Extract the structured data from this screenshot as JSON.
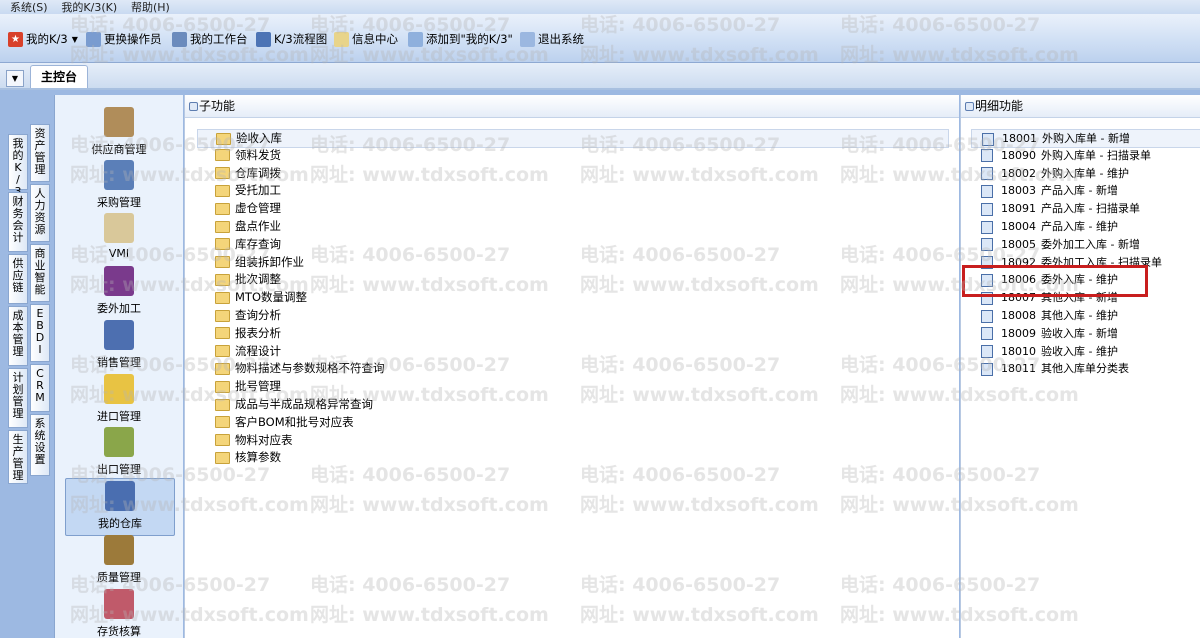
{
  "menubar": [
    "系统(S)",
    "我的K/3(K)",
    "帮助(H)"
  ],
  "toolbar": {
    "my_k3": "我的K/3",
    "switch_operator": "更换操作员",
    "my_workbench": "我的工作台",
    "k3_flowchart": "K/3流程图",
    "info_center": "信息中心",
    "add_to_my_k3": "添加到\"我的K/3\"",
    "exit_system": "退出系统"
  },
  "tabs": {
    "main": "主控台"
  },
  "left_tabs": {
    "col1": [
      [
        "我",
        "的",
        "K",
        "/",
        "3"
      ],
      [
        "财",
        "务",
        "会",
        "计"
      ],
      [
        "供",
        "应",
        "链"
      ],
      [
        "成",
        "本",
        "管",
        "理"
      ],
      [
        "计",
        "划",
        "管",
        "理"
      ],
      [
        "生",
        "产",
        "管",
        "理"
      ]
    ],
    "col2": [
      [
        "资",
        "产",
        "管",
        "理"
      ],
      [
        "人",
        "力",
        "资",
        "源"
      ],
      [
        "商",
        "业",
        "智",
        "能"
      ],
      [
        "E",
        "B",
        "D",
        "I"
      ],
      [
        "C",
        "R",
        "M"
      ],
      [
        "系",
        "统",
        "设",
        "置"
      ]
    ]
  },
  "categories": [
    "供应商管理",
    "采购管理",
    "VMI",
    "委外加工",
    "销售管理",
    "进口管理",
    "出口管理",
    "我的仓库",
    "质量管理",
    "存货核算"
  ],
  "sub_functions": {
    "title": "子功能",
    "items": [
      "验收入库",
      "领料发货",
      "仓库调拨",
      "受托加工",
      "虚仓管理",
      "盘点作业",
      "库存查询",
      "组装拆卸作业",
      "批次调整",
      "MTO数量调整",
      "查询分析",
      "报表分析",
      "流程设计",
      "物料描述与参数规格不符查询",
      "批号管理",
      "成品与半成品规格异常查询",
      "客户BOM和批号对应表",
      "物料对应表",
      "核算参数"
    ]
  },
  "detail_functions": {
    "title": "明细功能",
    "items": [
      {
        "code": "18001",
        "name": "外购入库单 - 新增"
      },
      {
        "code": "18090",
        "name": "外购入库单 - 扫描录单"
      },
      {
        "code": "18002",
        "name": "外购入库单 - 维护"
      },
      {
        "code": "18003",
        "name": "产品入库 - 新增"
      },
      {
        "code": "18091",
        "name": "产品入库 - 扫描录单"
      },
      {
        "code": "18004",
        "name": "产品入库 - 维护"
      },
      {
        "code": "18005",
        "name": "委外加工入库 - 新增"
      },
      {
        "code": "18092",
        "name": "委外加工入库 - 扫描录单"
      },
      {
        "code": "18006",
        "name": "委外入库 - 维护"
      },
      {
        "code": "18007",
        "name": "其他入库 - 新增"
      },
      {
        "code": "18008",
        "name": "其他入库 - 维护"
      },
      {
        "code": "18009",
        "name": "验收入库 - 新增"
      },
      {
        "code": "18010",
        "name": "验收入库 - 维护"
      },
      {
        "code": "18011",
        "name": "其他入库单分类表"
      }
    ]
  },
  "watermark": {
    "phone": "电话: 4006-6500-27",
    "site": "网址: www.tdxsoft.com"
  }
}
